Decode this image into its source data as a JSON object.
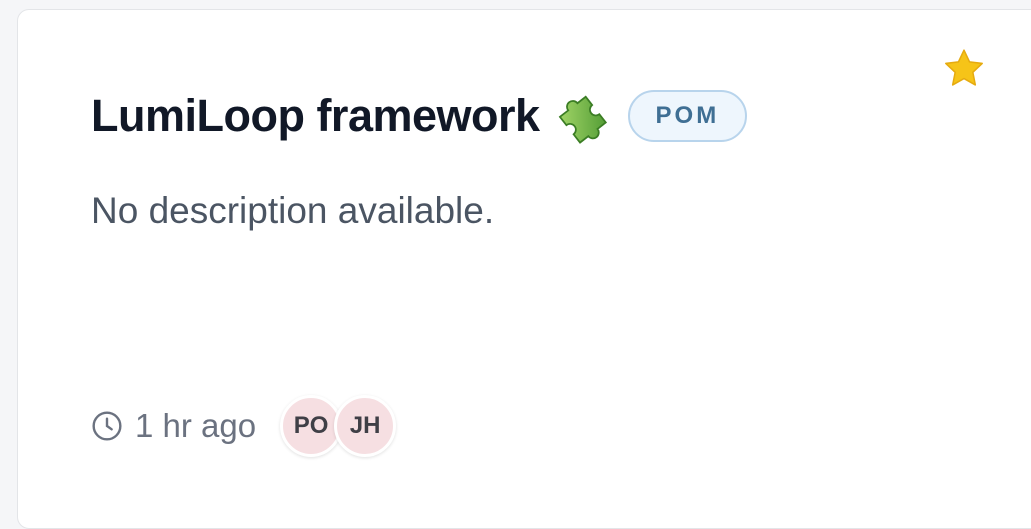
{
  "card": {
    "title": "LumiLoop framework",
    "title_icon": "puzzle-piece-icon",
    "badge": "POM",
    "description": "No description available.",
    "starred": true,
    "star_icon": "star-icon",
    "meta": {
      "clock_icon": "clock-icon",
      "time": "1 hr ago",
      "avatars": [
        {
          "initials": "PO"
        },
        {
          "initials": "JH"
        }
      ]
    }
  },
  "colors": {
    "star": "#f6c418",
    "badge_border": "#b8d4ec",
    "badge_text": "#3f6f94",
    "avatar_bg": "#f6dfe2"
  }
}
